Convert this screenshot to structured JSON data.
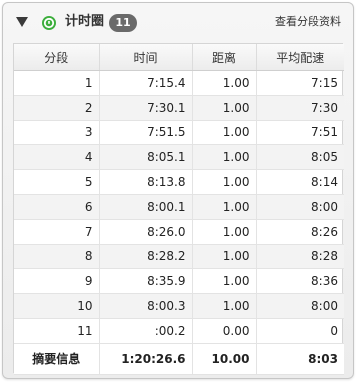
{
  "header": {
    "title": "计时圈",
    "count": "11",
    "details_link": "查看分段资料"
  },
  "table": {
    "columns": [
      "分段",
      "时间",
      "距离",
      "平均配速"
    ],
    "rows": [
      {
        "lap": "1",
        "time": "7:15.4",
        "distance": "1.00",
        "pace": "7:15"
      },
      {
        "lap": "2",
        "time": "7:30.1",
        "distance": "1.00",
        "pace": "7:30"
      },
      {
        "lap": "3",
        "time": "7:51.5",
        "distance": "1.00",
        "pace": "7:51"
      },
      {
        "lap": "4",
        "time": "8:05.1",
        "distance": "1.00",
        "pace": "8:05"
      },
      {
        "lap": "5",
        "time": "8:13.8",
        "distance": "1.00",
        "pace": "8:14"
      },
      {
        "lap": "6",
        "time": "8:00.1",
        "distance": "1.00",
        "pace": "8:00"
      },
      {
        "lap": "7",
        "time": "8:26.0",
        "distance": "1.00",
        "pace": "8:26"
      },
      {
        "lap": "8",
        "time": "8:28.2",
        "distance": "1.00",
        "pace": "8:28"
      },
      {
        "lap": "9",
        "time": "8:35.9",
        "distance": "1.00",
        "pace": "8:36"
      },
      {
        "lap": "10",
        "time": "8:00.3",
        "distance": "1.00",
        "pace": "8:00"
      },
      {
        "lap": "11",
        "time": ":00.2",
        "distance": "0.00",
        "pace": "0"
      }
    ],
    "summary": {
      "label": "摘要信息",
      "time": "1:20:26.6",
      "distance": "10.00",
      "pace": "8:03"
    }
  },
  "icons": {
    "collapse": "triangle-down-icon",
    "lap": "green-lap-icon"
  },
  "colors": {
    "lap_icon": "#3cae3c",
    "badge": "#6a6a6a"
  }
}
